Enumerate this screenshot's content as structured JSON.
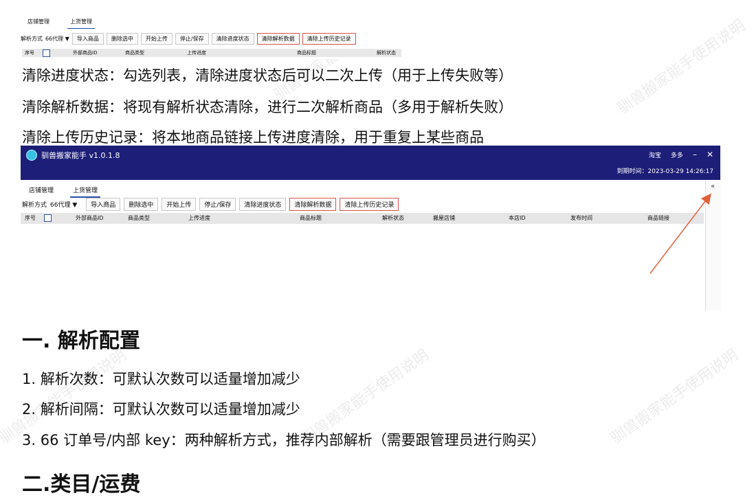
{
  "mini": {
    "tabs": [
      "店铺管理",
      "上货管理"
    ],
    "parse_label": "解析方式",
    "parse_value": "66代理",
    "buttons": [
      "导入商品",
      "删除选中",
      "开始上传",
      "停止/保存",
      "清除进度状态",
      "清除解析数据",
      "清除上传历史记录"
    ],
    "columns": [
      "序号",
      "外部商品ID",
      "商品类型",
      "上传进度",
      "商品标题",
      "解析状态"
    ]
  },
  "paragraphs": [
    "清除进度状态：勾选列表，清除进度状态后可以二次上传（用于上传失败等）",
    "清除解析数据：将现有解析状态清除，进行二次解析商品（多用于解析失败）",
    "清除上传历史记录：将本地商品链接上传进度清除，用于重复上某些商品"
  ],
  "app": {
    "title": "驯兽搬家能手 v1.0.1.8",
    "platform_links": [
      "淘宝",
      "多多"
    ],
    "window_controls": [
      "–",
      "✕"
    ],
    "expire": "到期时间：2023-03-29 14:26:17",
    "tabs": [
      "店铺管理",
      "上货管理"
    ],
    "parse_label": "解析方式",
    "parse_value": "66代理",
    "buttons": [
      "导入商品",
      "删除选中",
      "开始上传",
      "停止/保存",
      "清除进度状态",
      "清除解析数据",
      "清除上传历史记录"
    ],
    "columns": [
      "序号",
      "外部商品ID",
      "商品类型",
      "上传进度",
      "商品标题",
      "解析状态",
      "搬屋店铺",
      "本店ID",
      "发布时间",
      "商品链接"
    ],
    "collapse_glyph": "«"
  },
  "section1": {
    "heading": "一. 解析配置",
    "items": [
      "1. 解析次数：可默认次数可以适量增加减少",
      "2. 解析间隔：可默认次数可以适量增加减少",
      "3. 66 订单号/内部 key：两种解析方式，推荐内部解析（需要跟管理员进行购买）"
    ]
  },
  "section2": {
    "heading": "二.类目/运费"
  },
  "watermark": "驯兽搬家能手使用说明",
  "colors": {
    "titlebar": "#1c1e78",
    "arrow": "#e0603a",
    "highlight_border": "#d9534f"
  }
}
